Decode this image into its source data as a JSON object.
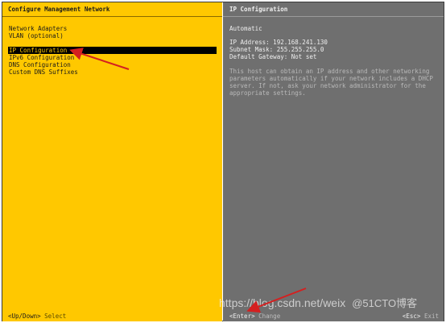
{
  "left_panel": {
    "title": "Configure Management Network",
    "menu": [
      {
        "label": "Network Adapters"
      },
      {
        "label": "VLAN (optional)"
      },
      {
        "label": "IP Configuration"
      },
      {
        "label": "IPv6 Configuration"
      },
      {
        "label": "DNS Configuration"
      },
      {
        "label": "Custom DNS Suffixes"
      }
    ],
    "selected_item": "IP Configuration",
    "footer_key": "<Up/Down>",
    "footer_action": "Select"
  },
  "right_panel": {
    "title": "IP Configuration",
    "mode": "Automatic",
    "ip_address": "IP Address: 192.168.241.130",
    "subnet_mask": "Subnet Mask: 255.255.255.0",
    "default_gateway": "Default Gateway: Not set",
    "help_text": "This host can obtain an IP address and other networking parameters automatically if your network includes a DHCP server. If not, ask your network administrator for the appropriate settings.",
    "footer_key": "<Enter>",
    "footer_action": "Change",
    "exit_key": "<Esc>",
    "exit_action": "Exit"
  },
  "watermark": {
    "url": "https://blog.csdn.net/weix",
    "brand": "@51CTO博客"
  },
  "colors": {
    "left_bg": "#ffc800",
    "right_bg": "#6f6f6f",
    "annotation_arrow": "#d42020"
  }
}
